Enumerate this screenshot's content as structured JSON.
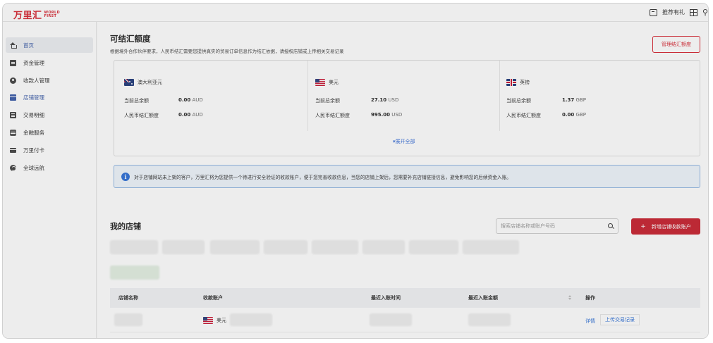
{
  "brand": {
    "name_cn": "万里汇",
    "name_en_1": "WORLD",
    "name_en_2": "FIRST"
  },
  "topbar": {
    "referral": "推荐有礼"
  },
  "sidebar": {
    "items": [
      {
        "label": "首页",
        "active": true
      },
      {
        "label": "资金管理",
        "active": false
      },
      {
        "label": "收款人管理",
        "active": false
      },
      {
        "label": "店铺管理",
        "active": false
      },
      {
        "label": "交易明细",
        "active": false
      },
      {
        "label": "金融服务",
        "active": false
      },
      {
        "label": "万里付卡",
        "active": false
      },
      {
        "label": "全球远航",
        "active": false
      }
    ]
  },
  "settlement": {
    "title": "可结汇额度",
    "subtitle": "根据境外合作伙伴要求，人民币结汇需要您提供真实的贸易订单信息作为结汇依据，请授权店铺或上传相关交易记录",
    "manage_button": "管理结汇额度",
    "currencies": [
      {
        "name": "澳大利亚元",
        "flag": "au-flag-icon",
        "balance_label": "当前总余额",
        "balance_value": "0.00",
        "balance_unit": "AUD",
        "quota_label": "人民币结汇额度",
        "quota_value": "0.00",
        "quota_unit": "AUD"
      },
      {
        "name": "美元",
        "flag": "us-flag-icon",
        "balance_label": "当前总余额",
        "balance_value": "27.10",
        "balance_unit": "USD",
        "quota_label": "人民币结汇额度",
        "quota_value": "995.00",
        "quota_unit": "USD"
      },
      {
        "name": "英镑",
        "flag": "gb-flag-icon",
        "balance_label": "当前总余额",
        "balance_value": "1.37",
        "balance_unit": "GBP",
        "quota_label": "人民币结汇额度",
        "quota_value": "0.00",
        "quota_unit": "GBP"
      }
    ],
    "expand_all": "▾展开全部"
  },
  "notice": {
    "text": "对于店铺网站未上架的客户，万里汇将为您提供一个待进行安全验证的收款账户，便于您完善收款信息，当您的店铺上架后，您需要补充店铺链接信息，避免影响您的后续资金入账。"
  },
  "stores": {
    "title": "我的店铺",
    "search_placeholder": "搜索店铺名称或账户号码",
    "add_button": "新增店铺收款账户",
    "columns": [
      "店铺名称",
      "收款账户",
      "最近入账时间",
      "最近入账金额",
      "操作"
    ],
    "rows": [
      {
        "account_currency": "美元",
        "detail": "详情",
        "upload": "上传交易记录"
      }
    ]
  },
  "colors": {
    "brand_red": "#d6232f",
    "link_blue": "#2d6fd6",
    "nav_active": "#3a5ba8"
  }
}
